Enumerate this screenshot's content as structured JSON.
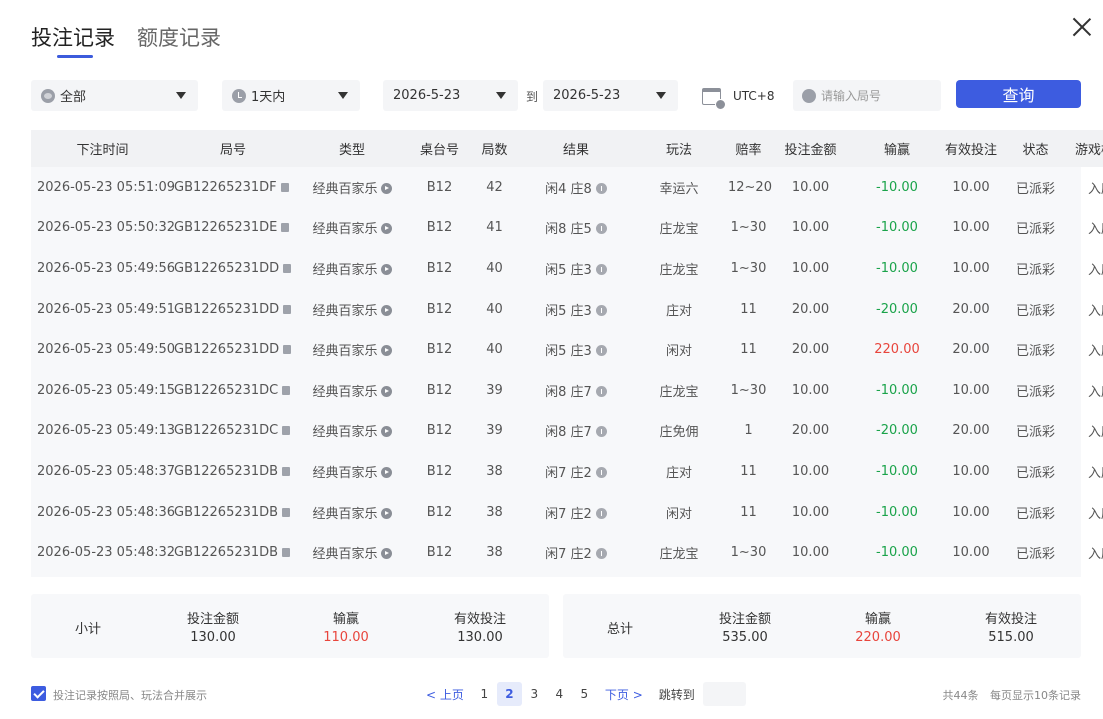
{
  "tabs": [
    {
      "label": "投注记录",
      "active": true
    },
    {
      "label": "额度记录",
      "active": false
    }
  ],
  "filters": {
    "scope": "全部",
    "range": "1天内",
    "date_from": "2026-5-23",
    "to_label": "到",
    "date_to": "2026-5-23",
    "timezone": "UTC+8",
    "round_placeholder": "请输入局号",
    "query_label": "查询"
  },
  "table": {
    "headers": [
      "下注时间",
      "局号",
      "类型",
      "桌台号",
      "局数",
      "结果",
      "玩法",
      "赔率",
      "投注金额",
      "输赢",
      "有效投注",
      "状态",
      "游戏模式"
    ],
    "rows": [
      {
        "time": "2026-05-23 05:51:09",
        "id": "GB12265231DF",
        "type": "经典百家乐",
        "table": "B12",
        "round": "42",
        "result": "闲4 庄8",
        "play": "幸运六",
        "odds": "12~20",
        "bet": "10.00",
        "winloss": "-10.00",
        "sign": "neg",
        "valid": "10.00",
        "status": "已派彩",
        "mode": "入座"
      },
      {
        "time": "2026-05-23 05:50:32",
        "id": "GB12265231DE",
        "type": "经典百家乐",
        "table": "B12",
        "round": "41",
        "result": "闲8 庄5",
        "play": "庄龙宝",
        "odds": "1~30",
        "bet": "10.00",
        "winloss": "-10.00",
        "sign": "neg",
        "valid": "10.00",
        "status": "已派彩",
        "mode": "入座"
      },
      {
        "time": "2026-05-23 05:49:56",
        "id": "GB12265231DD",
        "type": "经典百家乐",
        "table": "B12",
        "round": "40",
        "result": "闲5 庄3",
        "play": "庄龙宝",
        "odds": "1~30",
        "bet": "10.00",
        "winloss": "-10.00",
        "sign": "neg",
        "valid": "10.00",
        "status": "已派彩",
        "mode": "入座"
      },
      {
        "time": "2026-05-23 05:49:51",
        "id": "GB12265231DD",
        "type": "经典百家乐",
        "table": "B12",
        "round": "40",
        "result": "闲5 庄3",
        "play": "庄对",
        "odds": "11",
        "bet": "20.00",
        "winloss": "-20.00",
        "sign": "neg",
        "valid": "20.00",
        "status": "已派彩",
        "mode": "入座"
      },
      {
        "time": "2026-05-23 05:49:50",
        "id": "GB12265231DD",
        "type": "经典百家乐",
        "table": "B12",
        "round": "40",
        "result": "闲5 庄3",
        "play": "闲对",
        "odds": "11",
        "bet": "20.00",
        "winloss": "220.00",
        "sign": "pos",
        "valid": "20.00",
        "status": "已派彩",
        "mode": "入座"
      },
      {
        "time": "2026-05-23 05:49:15",
        "id": "GB12265231DC",
        "type": "经典百家乐",
        "table": "B12",
        "round": "39",
        "result": "闲8 庄7",
        "play": "庄龙宝",
        "odds": "1~30",
        "bet": "10.00",
        "winloss": "-10.00",
        "sign": "neg",
        "valid": "10.00",
        "status": "已派彩",
        "mode": "入座"
      },
      {
        "time": "2026-05-23 05:49:13",
        "id": "GB12265231DC",
        "type": "经典百家乐",
        "table": "B12",
        "round": "39",
        "result": "闲8 庄7",
        "play": "庄免佣",
        "odds": "1",
        "bet": "20.00",
        "winloss": "-20.00",
        "sign": "neg",
        "valid": "20.00",
        "status": "已派彩",
        "mode": "入座"
      },
      {
        "time": "2026-05-23 05:48:37",
        "id": "GB12265231DB",
        "type": "经典百家乐",
        "table": "B12",
        "round": "38",
        "result": "闲7 庄2",
        "play": "庄对",
        "odds": "11",
        "bet": "10.00",
        "winloss": "-10.00",
        "sign": "neg",
        "valid": "10.00",
        "status": "已派彩",
        "mode": "入座"
      },
      {
        "time": "2026-05-23 05:48:36",
        "id": "GB12265231DB",
        "type": "经典百家乐",
        "table": "B12",
        "round": "38",
        "result": "闲7 庄2",
        "play": "闲对",
        "odds": "11",
        "bet": "10.00",
        "winloss": "-10.00",
        "sign": "neg",
        "valid": "10.00",
        "status": "已派彩",
        "mode": "入座"
      },
      {
        "time": "2026-05-23 05:48:32",
        "id": "GB12265231DB",
        "type": "经典百家乐",
        "table": "B12",
        "round": "38",
        "result": "闲7 庄2",
        "play": "庄龙宝",
        "odds": "1~30",
        "bet": "10.00",
        "winloss": "-10.00",
        "sign": "neg",
        "valid": "10.00",
        "status": "已派彩",
        "mode": "入座"
      }
    ]
  },
  "subtotal": {
    "label": "小计",
    "bet_label": "投注金额",
    "bet": "130.00",
    "winloss_label": "输赢",
    "winloss": "110.00",
    "valid_label": "有效投注",
    "valid": "130.00"
  },
  "total": {
    "label": "总计",
    "bet_label": "投注金额",
    "bet": "535.00",
    "winloss_label": "输赢",
    "winloss": "220.00",
    "valid_label": "有效投注",
    "valid": "515.00"
  },
  "footer": {
    "merge_label": "投注记录按照局、玩法合并展示",
    "prev_label": "< 上页",
    "next_label": "下页 >",
    "pages": [
      "1",
      "2",
      "3",
      "4",
      "5"
    ],
    "current_page": "2",
    "jump_label": "跳转到",
    "total_count": "共44条",
    "per_page": "每页显示10条记录"
  },
  "colors": {
    "accent": "#3d5ce0",
    "win": "#e8453c",
    "loss": "#1aa34a"
  }
}
